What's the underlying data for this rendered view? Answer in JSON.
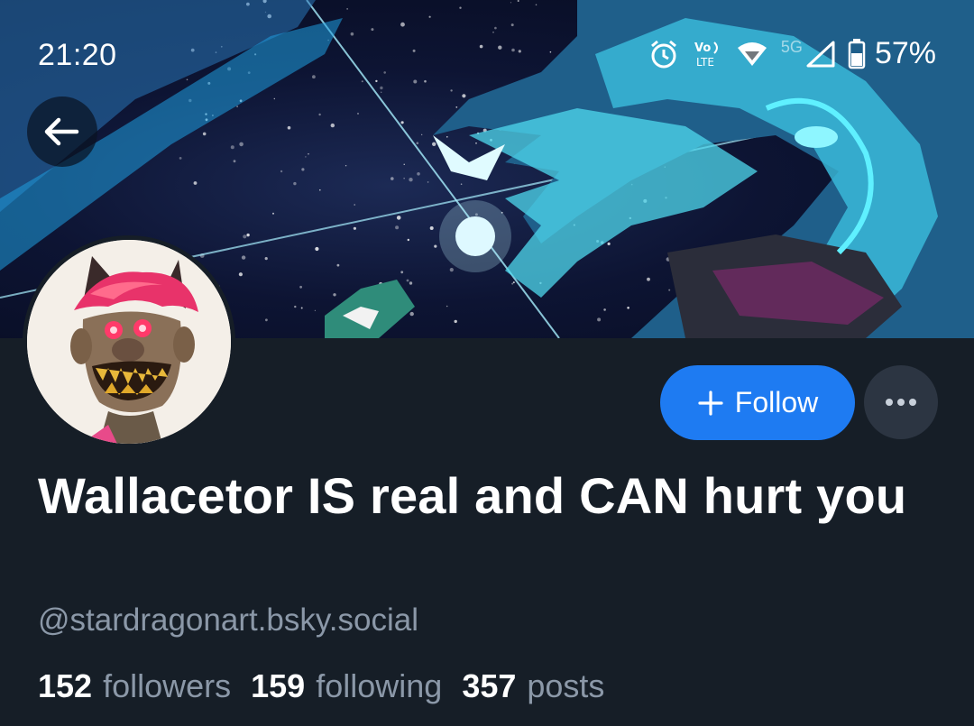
{
  "status_bar": {
    "time": "21:20",
    "network_label": "5G",
    "battery_percent": "57%",
    "icons": [
      "alarm-icon",
      "volte-icon",
      "wifi-icon",
      "signal-icon",
      "battery-icon"
    ]
  },
  "navigation": {
    "back_icon": "arrow-left-icon"
  },
  "profile": {
    "display_name": "Wallacetor IS real and CAN hurt you",
    "handle": "@stardragonart.bsky.social",
    "stats": {
      "followers_count": "152",
      "followers_label": "followers",
      "following_count": "159",
      "following_label": "following",
      "posts_count": "357",
      "posts_label": "posts"
    }
  },
  "actions": {
    "follow_label": "Follow",
    "follow_icon": "plus-icon",
    "more_icon": "ellipsis-icon"
  },
  "colors": {
    "background": "#161e27",
    "accent": "#1e7bf2",
    "secondary_button": "#2c3542",
    "muted_text": "#8b98a8"
  }
}
